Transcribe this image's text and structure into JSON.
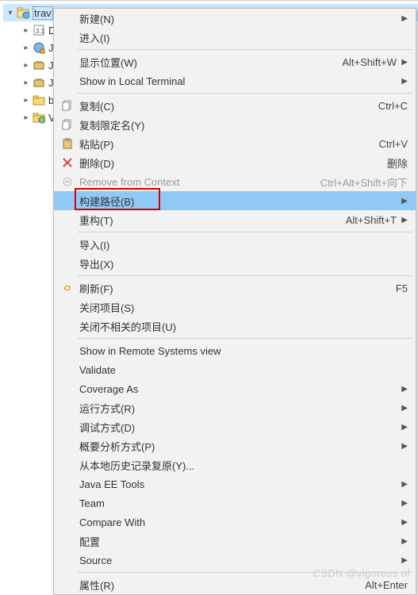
{
  "tree": {
    "root": {
      "label": "trav",
      "expanded": true
    },
    "children": [
      {
        "label": "D",
        "icon": "dd-icon"
      },
      {
        "label": "J",
        "icon": "jax-icon"
      },
      {
        "label": "J",
        "icon": "jar-lib-icon"
      },
      {
        "label": "J",
        "icon": "jar-lib2-icon"
      },
      {
        "label": "b",
        "icon": "folder-b-icon"
      },
      {
        "label": "V",
        "icon": "folder-v-icon"
      }
    ]
  },
  "menu": {
    "new": {
      "label": "新建(N)"
    },
    "into": {
      "label": "进入(I)"
    },
    "show_in": {
      "label": "显示位置(W)",
      "shortcut": "Alt+Shift+W"
    },
    "show_local_terminal": {
      "label": "Show in Local Terminal"
    },
    "copy": {
      "label": "复制(C)",
      "shortcut": "Ctrl+C"
    },
    "copy_qualified": {
      "label": "复制限定名(Y)"
    },
    "paste": {
      "label": "粘贴(P)",
      "shortcut": "Ctrl+V"
    },
    "delete": {
      "label": "删除(D)",
      "shortcut": "删除"
    },
    "remove_from_context": {
      "label": "Remove from Context",
      "shortcut": "Ctrl+Alt+Shift+向下"
    },
    "build_path": {
      "label": "构建路径(B)"
    },
    "refactor": {
      "label": "重构(T)",
      "shortcut": "Alt+Shift+T"
    },
    "import": {
      "label": "导入(I)"
    },
    "export": {
      "label": "导出(X)"
    },
    "refresh": {
      "label": "刷新(F)",
      "shortcut": "F5"
    },
    "close_project": {
      "label": "关闭项目(S)"
    },
    "close_unrelated": {
      "label": "关闭不相关的项目(U)"
    },
    "show_remote": {
      "label": "Show in Remote Systems view"
    },
    "validate": {
      "label": "Validate"
    },
    "coverage_as": {
      "label": "Coverage As"
    },
    "run_as": {
      "label": "运行方式(R)"
    },
    "debug_as": {
      "label": "调试方式(D)"
    },
    "profile_as": {
      "label": "概要分析方式(P)"
    },
    "restore_local_history": {
      "label": "从本地历史记录复原(Y)..."
    },
    "java_ee_tools": {
      "label": "Java EE Tools"
    },
    "team": {
      "label": "Team"
    },
    "compare_with": {
      "label": "Compare With"
    },
    "configure": {
      "label": "配置"
    },
    "source": {
      "label": "Source"
    },
    "properties": {
      "label": "属性(R)",
      "shortcut": "Alt+Enter"
    }
  },
  "watermark": "CSDN @vigorous of"
}
